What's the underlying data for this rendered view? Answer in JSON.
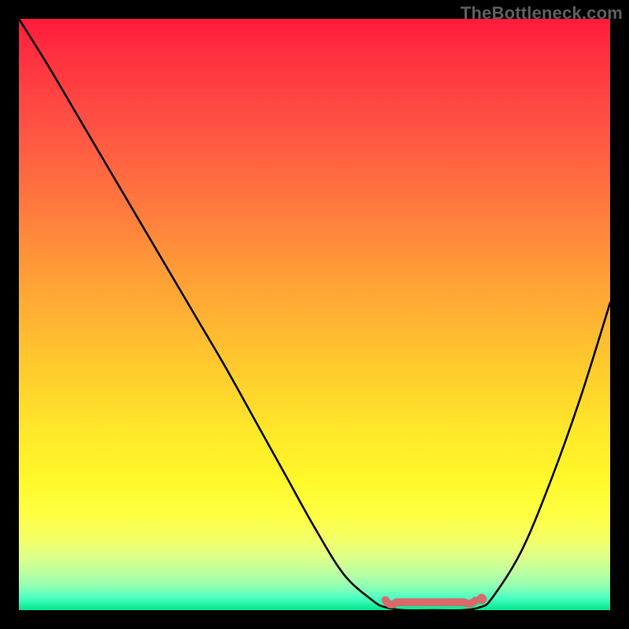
{
  "watermark": "TheBottleneck.com",
  "colors": {
    "background": "#000000",
    "curve": "#000000",
    "zone_marker": "#d86a6b",
    "zone_dot": "#d86a6b"
  },
  "chart_data": {
    "type": "line",
    "title": "",
    "xlabel": "",
    "ylabel": "",
    "xlim": [
      0,
      100
    ],
    "ylim": [
      0,
      100
    ],
    "grid": false,
    "series": [
      {
        "name": "bottleneck_curve",
        "x": [
          0,
          5,
          10,
          15,
          20,
          25,
          30,
          35,
          40,
          45,
          50,
          55,
          60,
          62,
          65,
          70,
          75,
          78,
          80,
          85,
          90,
          95,
          100
        ],
        "values": [
          100,
          92,
          83.5,
          75,
          66.5,
          58,
          49.5,
          41,
          32,
          23,
          14,
          6,
          1.5,
          0.5,
          0,
          0,
          0,
          0.5,
          2,
          10,
          22,
          36,
          52
        ]
      }
    ],
    "optimal_zone": {
      "start_x": 62,
      "end_x": 78,
      "dot_x": 78,
      "y": 0
    },
    "gradient_stops": [
      {
        "pos": 0,
        "color": "#ff1a3c"
      },
      {
        "pos": 84,
        "color": "#feff44"
      },
      {
        "pos": 100,
        "color": "#00e88a"
      }
    ]
  }
}
